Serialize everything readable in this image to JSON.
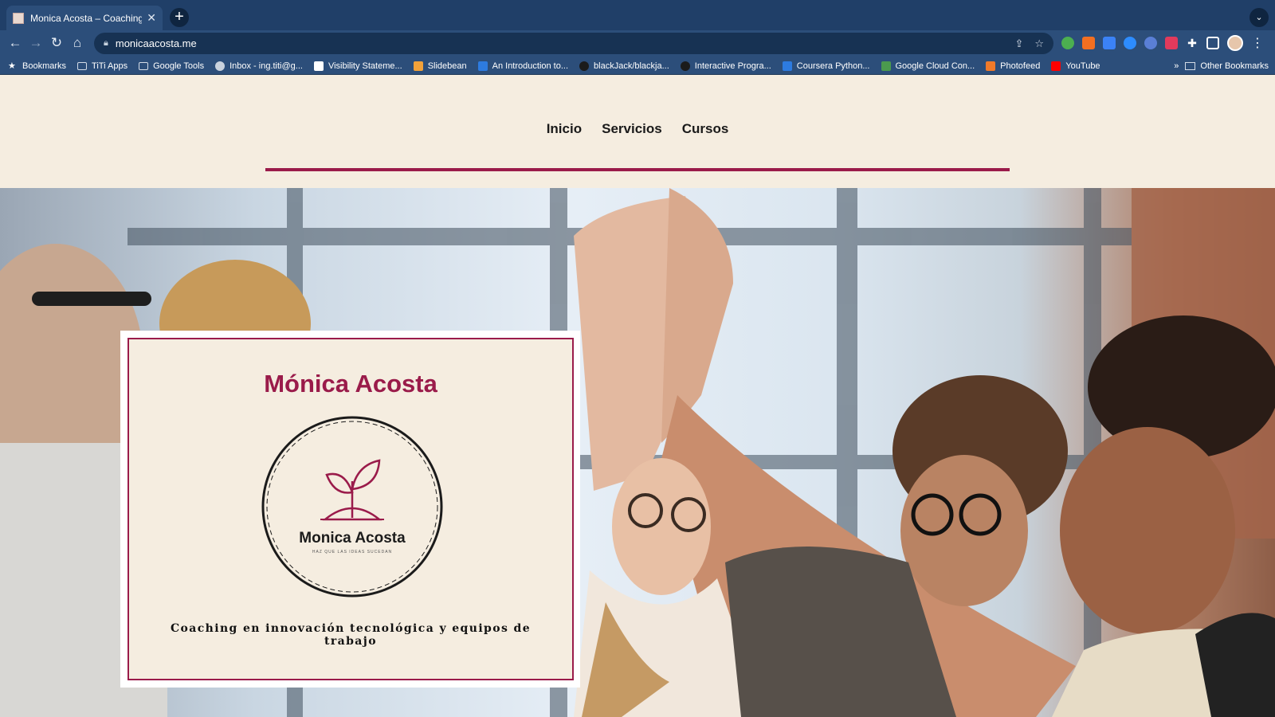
{
  "browser": {
    "tab": {
      "title": "Monica Acosta – Coaching"
    },
    "address": {
      "url": "monicaacosta.me"
    },
    "bookmarks": [
      {
        "label": "Bookmarks",
        "icon": "star-icon",
        "color": "#ffffff"
      },
      {
        "label": "TiTi Apps",
        "icon": "folder-icon",
        "color": "#d3dbe6"
      },
      {
        "label": "Google Tools",
        "icon": "folder-icon",
        "color": "#d3dbe6"
      },
      {
        "label": "Inbox - ing.titi@g...",
        "icon": "globe-icon",
        "color": "#c9d2de"
      },
      {
        "label": "Visibility Stateme...",
        "icon": "y-icon",
        "color": "#ffffff"
      },
      {
        "label": "Slidebean",
        "icon": "slidebean-icon",
        "color": "#f2a23a"
      },
      {
        "label": "An Introduction to...",
        "icon": "c-icon",
        "color": "#2d7be0"
      },
      {
        "label": "blackJack/blackja...",
        "icon": "github-icon",
        "color": "#1b1b1b"
      },
      {
        "label": "Interactive Progra...",
        "icon": "github-icon",
        "color": "#1b1b1b"
      },
      {
        "label": "Coursera Python...",
        "icon": "coursera-icon",
        "color": "#2d7be0"
      },
      {
        "label": "Google Cloud Con...",
        "icon": "google-cloud-icon",
        "color": "#4b9a4e"
      },
      {
        "label": "Photofeed",
        "icon": "photofeed-icon",
        "color": "#f07a2a"
      },
      {
        "label": "YouTube",
        "icon": "youtube-icon",
        "color": "#ff0000"
      }
    ],
    "bookmarks_more": "»",
    "other_bookmarks": "Other Bookmarks"
  },
  "nav": {
    "items": [
      {
        "label": "Inicio"
      },
      {
        "label": "Servicios"
      },
      {
        "label": "Cursos"
      }
    ]
  },
  "hero": {
    "name": "Mónica Acosta",
    "logo_name": "Monica Acosta",
    "logo_slogan": "HAZ QUE LAS IDEAS SUCEDAN",
    "tagline": "Coaching en innovación tecnológica y equipos de trabajo"
  },
  "colors": {
    "accent": "#9a1b4a",
    "page_bg": "#f5ede0",
    "chrome_dark": "#203f68",
    "chrome_light": "#2c4e7a"
  }
}
